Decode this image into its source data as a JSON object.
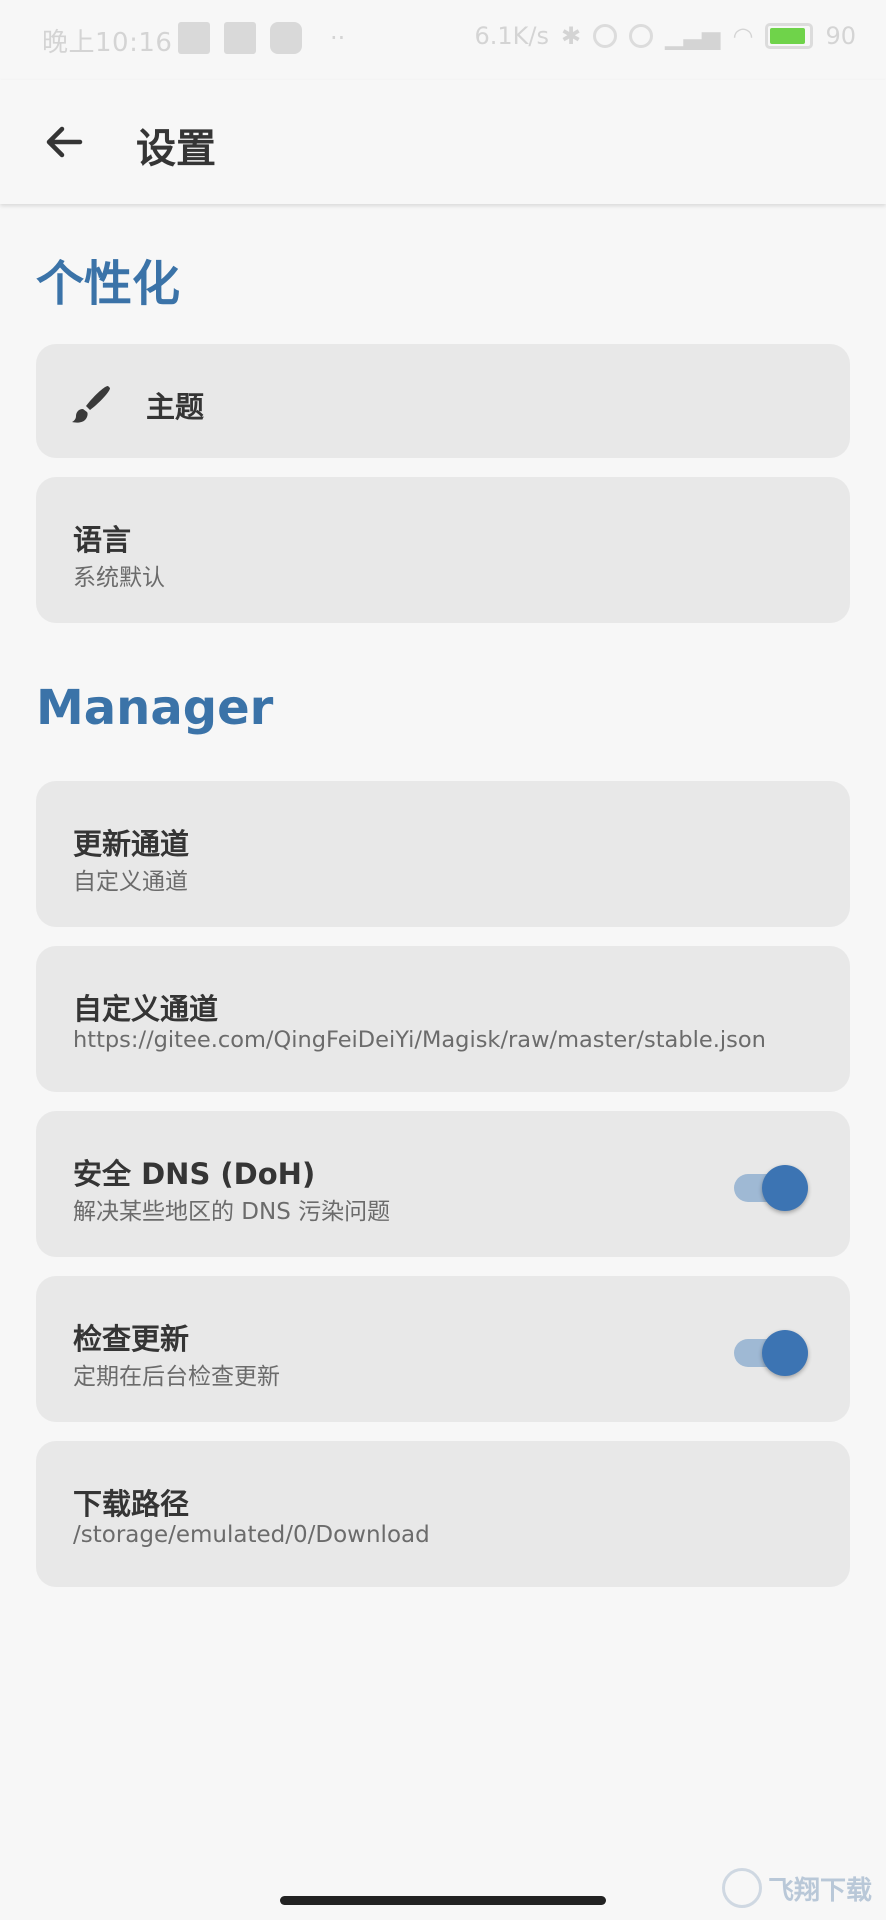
{
  "status_bar": {
    "time": "晚上10:16",
    "net_speed": "6.1K/s",
    "battery_pct": "90",
    "battery_level": 0.9,
    "battery_color": "#6fd34a"
  },
  "app_bar": {
    "title": "设置",
    "back_icon": "arrow-left-icon"
  },
  "sections": {
    "personalization": {
      "title": "个性化",
      "theme": {
        "title": "主题",
        "icon": "brush-icon"
      },
      "language": {
        "title": "语言",
        "subtitle": "系统默认"
      }
    },
    "manager": {
      "title": "Manager",
      "update_channel": {
        "title": "更新通道",
        "subtitle": "自定义通道"
      },
      "custom_channel": {
        "title": "自定义通道",
        "subtitle": "https://gitee.com/QingFeiDeiYi/Magisk/raw/master/stable.json"
      },
      "secure_dns": {
        "title": "安全 DNS (DoH)",
        "subtitle": "解决某些地区的 DNS 污染问题",
        "enabled": true
      },
      "check_update": {
        "title": "检查更新",
        "subtitle": "定期在后台检查更新",
        "enabled": true
      },
      "download_path": {
        "title": "下载路径",
        "subtitle": "/storage/emulated/0/Download"
      }
    }
  },
  "watermark": {
    "text": "飞翔下载"
  },
  "colors": {
    "accent": "#3b73a8",
    "card_bg": "#e8e8e8",
    "page_bg": "#f7f7f7",
    "toggle_thumb": "#3c74b3",
    "toggle_track": "#9fb9d4"
  }
}
